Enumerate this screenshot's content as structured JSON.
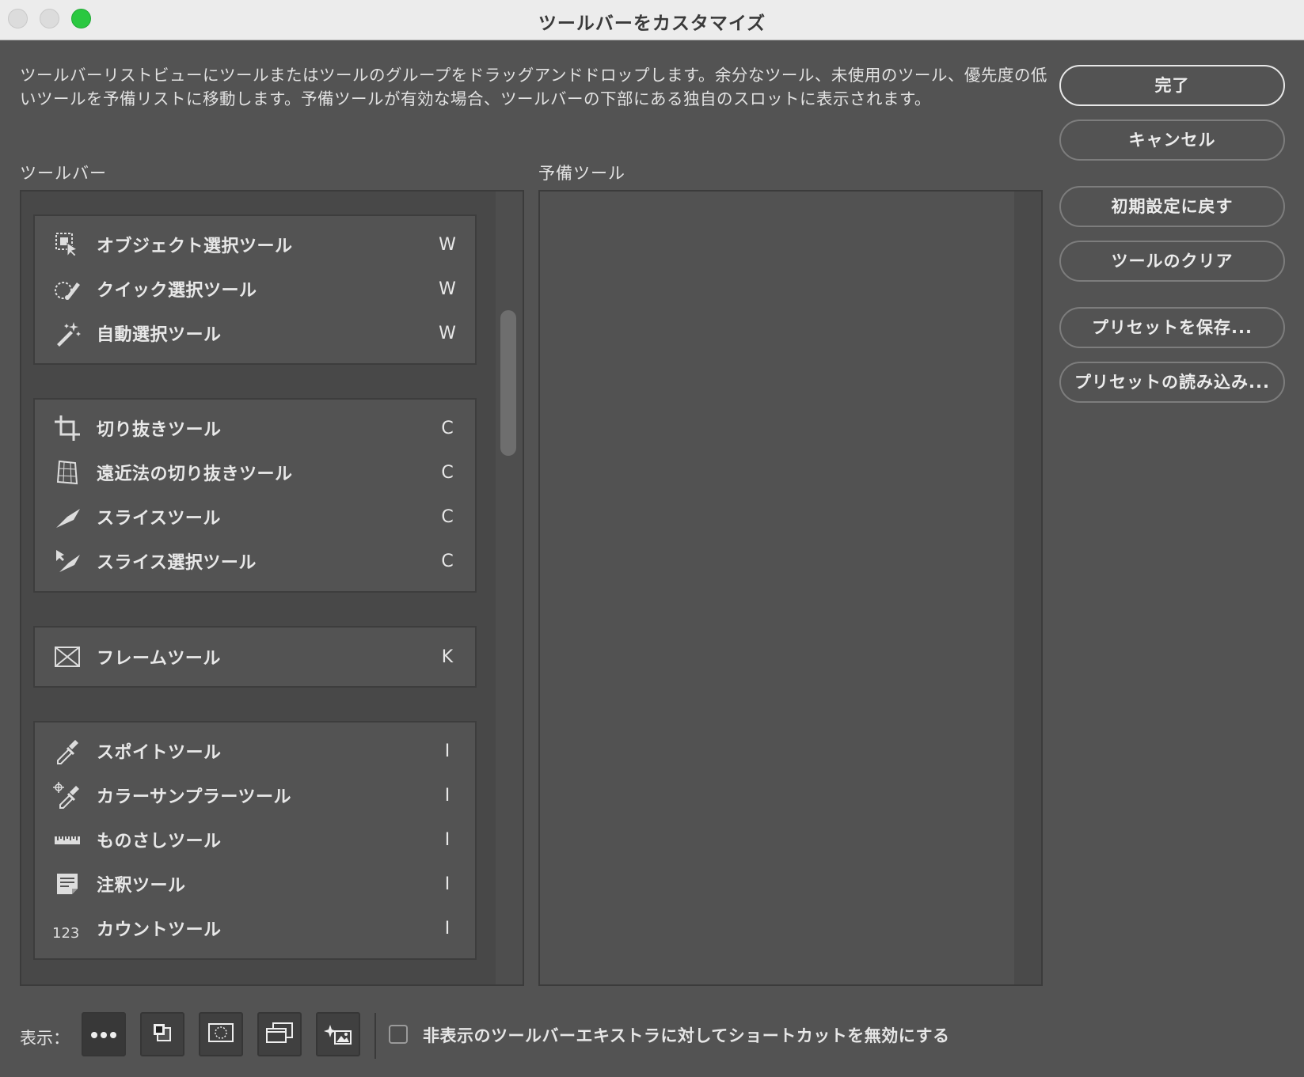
{
  "window": {
    "title": "ツールバーをカスタマイズ"
  },
  "description": "ツールバーリストビューにツールまたはツールのグループをドラッグアンドドロップします。余分なツール、未使用のツール、優先度の低いツールを予備リストに移動します。予備ツールが有効な場合、ツールバーの下部にある独自のスロットに表示されます。",
  "labels": {
    "toolbar": "ツールバー",
    "reserve": "予備ツール",
    "show": "表示："
  },
  "buttons": {
    "done": "完了",
    "cancel": "キャンセル",
    "reset": "初期設定に戻す",
    "clear": "ツールのクリア",
    "save_preset": "プリセットを保存...",
    "load_preset": "プリセットの読み込み..."
  },
  "groups": [
    {
      "tools": [
        {
          "name": "オブジェクト選択ツール",
          "key": "W",
          "icon": "object-selection-icon"
        },
        {
          "name": "クイック選択ツール",
          "key": "W",
          "icon": "quick-selection-icon"
        },
        {
          "name": "自動選択ツール",
          "key": "W",
          "icon": "magic-wand-icon"
        }
      ]
    },
    {
      "tools": [
        {
          "name": "切り抜きツール",
          "key": "C",
          "icon": "crop-icon"
        },
        {
          "name": "遠近法の切り抜きツール",
          "key": "C",
          "icon": "perspective-crop-icon"
        },
        {
          "name": "スライスツール",
          "key": "C",
          "icon": "slice-icon"
        },
        {
          "name": "スライス選択ツール",
          "key": "C",
          "icon": "slice-select-icon"
        }
      ]
    },
    {
      "tools": [
        {
          "name": "フレームツール",
          "key": "K",
          "icon": "frame-icon"
        }
      ]
    },
    {
      "tools": [
        {
          "name": "スポイトツール",
          "key": "I",
          "icon": "eyedropper-icon"
        },
        {
          "name": "カラーサンプラーツール",
          "key": "I",
          "icon": "color-sampler-icon"
        },
        {
          "name": "ものさしツール",
          "key": "I",
          "icon": "ruler-icon"
        },
        {
          "name": "注釈ツール",
          "key": "I",
          "icon": "note-icon"
        },
        {
          "name": "カウントツール",
          "key": "I",
          "icon": "count-icon"
        }
      ]
    }
  ],
  "count_icon_text": "123",
  "shortcut_checkbox": {
    "label": "非表示のツールバーエキストラに対してショートカットを無効にする",
    "checked": false
  }
}
